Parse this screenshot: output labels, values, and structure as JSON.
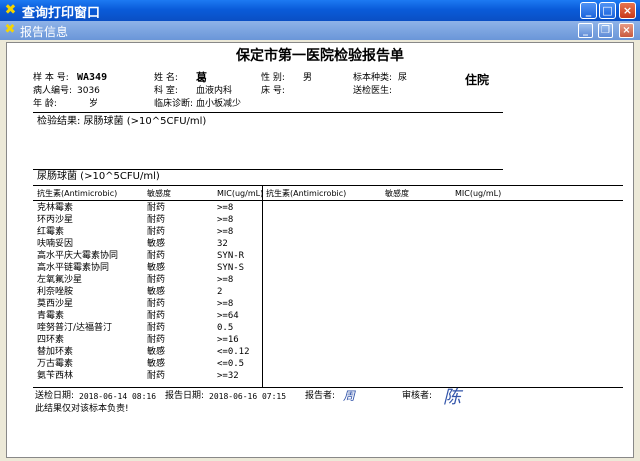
{
  "window": {
    "title": "查询打印窗口",
    "icon": "app-icon"
  },
  "child_window": {
    "title": "报告信息"
  },
  "report": {
    "title": "保定市第一医院检验报告单",
    "patient_type": "住院",
    "header_fields": [
      {
        "label": "样 本 号:",
        "value": "WA349"
      },
      {
        "label": "病人编号:",
        "value": "3036"
      },
      {
        "label": "年    龄:",
        "value": "岁"
      },
      {
        "label": "姓    名:",
        "value": "葛"
      },
      {
        "label": "科    室:",
        "value": "血液内科"
      },
      {
        "label": "临床诊断:",
        "value": "血小板减少"
      },
      {
        "label": "性    别:",
        "value": "男"
      },
      {
        "label": "床    号:",
        "value": ""
      },
      {
        "label": "标本种类:",
        "value": "尿"
      },
      {
        "label": "送检医生:",
        "value": ""
      }
    ],
    "result_line": "检验结果: 尿肠球菌 (>10^5CFU/ml)",
    "organism": "尿肠球菌 (>10^5CFU/ml)",
    "columns": {
      "antibiotic": "抗生素(Antimicrobic)",
      "sensitivity": "敏感度",
      "mic": "MIC(ug/mL)"
    },
    "rows": [
      {
        "drug": "克林霉素",
        "sens": "耐药",
        "mic": ">=8"
      },
      {
        "drug": "环丙沙星",
        "sens": "耐药",
        "mic": ">=8"
      },
      {
        "drug": "红霉素",
        "sens": "耐药",
        "mic": ">=8"
      },
      {
        "drug": "呋喃妥因",
        "sens": "敏感",
        "mic": "32"
      },
      {
        "drug": "高水平庆大霉素协同",
        "sens": "耐药",
        "mic": "SYN-R"
      },
      {
        "drug": "高水平链霉素协同",
        "sens": "敏感",
        "mic": "SYN-S"
      },
      {
        "drug": "左氧氟沙星",
        "sens": "耐药",
        "mic": ">=8"
      },
      {
        "drug": "利奈唑胺",
        "sens": "敏感",
        "mic": "2"
      },
      {
        "drug": "莫西沙星",
        "sens": "耐药",
        "mic": ">=8"
      },
      {
        "drug": "青霉素",
        "sens": "耐药",
        "mic": ">=64"
      },
      {
        "drug": "喹努普汀/达福普汀",
        "sens": "耐药",
        "mic": "0.5"
      },
      {
        "drug": "四环素",
        "sens": "耐药",
        "mic": ">=16"
      },
      {
        "drug": "替加环素",
        "sens": "敏感",
        "mic": "<=0.12"
      },
      {
        "drug": "万古霉素",
        "sens": "敏感",
        "mic": "<=0.5"
      },
      {
        "drug": "氨苄西林",
        "sens": "耐药",
        "mic": ">=32"
      }
    ],
    "footer": {
      "sample_date_label": "送检日期:",
      "sample_date": "2018-06-14 08:16",
      "report_date_label": "报告日期:",
      "report_date": "2018-06-16 07:15",
      "reporter_label": "报告者:",
      "reporter_signature": "周",
      "reviewer_label": "审核者:",
      "reviewer_signature": "陈",
      "disclaimer": "此结果仅对该标本负责!"
    }
  }
}
